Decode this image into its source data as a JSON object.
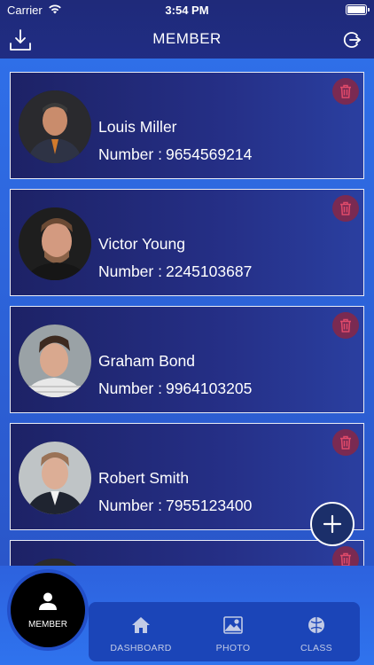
{
  "status_bar": {
    "carrier": "Carrier",
    "time": "3:54 PM"
  },
  "nav": {
    "title": "MEMBER",
    "left_icon": "download-icon",
    "right_icon": "logout-icon"
  },
  "members": [
    {
      "name": "Louis Miller",
      "number_label": "Number :",
      "number": "9654569214"
    },
    {
      "name": "Victor Young",
      "number_label": "Number :",
      "number": "2245103687"
    },
    {
      "name": "Graham Bond",
      "number_label": "Number :",
      "number": "9964103205"
    },
    {
      "name": "Robert Smith",
      "number_label": "Number :",
      "number": "7955123400"
    }
  ],
  "tabs": {
    "member": "MEMBER",
    "dashboard": "DASHBOARD",
    "photo": "PHOTO",
    "class": "CLASS"
  },
  "colors": {
    "accent": "#2f6fe8",
    "card_bg": "#1d2266",
    "delete_bg": "#7a2a52",
    "tab_bar": "#1b45b8"
  }
}
